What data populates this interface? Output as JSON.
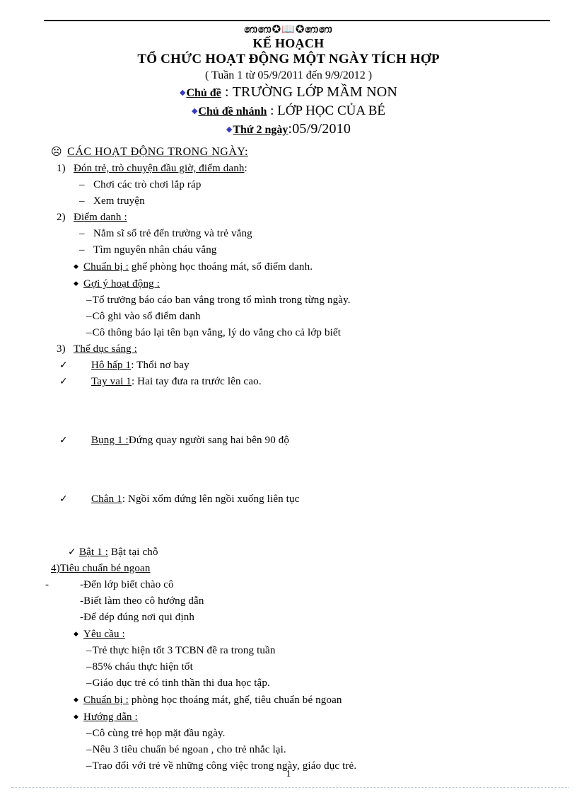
{
  "document": {
    "ornament": "ΨΨ⊛📖⊛ΨΨ",
    "ornament_glyphs": "෩෩✪📖✪෩෩",
    "title_line1": "KẾ HOẠCH",
    "title_line2": "TỔ CHỨC HOẠT ĐỘNG MỘT NGÀY TÍCH HỢP",
    "subtitle": "(  Tuần 1 từ 05/9/2011  đến 9/9/2012  )",
    "page_number": "1"
  },
  "meta": {
    "theme_label": "Chủ đề",
    "theme_value": "TRƯỜNG  LỚP MẦM  NON",
    "subtheme_label": "Chủ đề nhánh",
    "subtheme_value": "LỚP HỌC CỦA BÉ",
    "day_label": "Thứ 2 ngày",
    "day_value": "05/9/2010",
    "bullet_icon": "diamond-icon",
    "colon": ":"
  },
  "section": {
    "icon": "frowning-face-icon",
    "icon_glyph": "☹",
    "heading": "CÁC HOẠT ĐỘNG TRONG NGÀY:"
  },
  "items": [
    {
      "number": "1)",
      "title": "Đón trẻ, trò chuyện đầu giờ, điểm danh",
      "title_suffix": ":",
      "dashes": [
        "Chơi  các trò chơi lắp ráp",
        "Xem truyện"
      ]
    },
    {
      "number": "2)",
      "title": "Điểm danh :",
      "title_suffix": "",
      "dashes": [
        "Nắm sĩ số trẻ đến trường và  trẻ vắng",
        "Tìm nguyên nhân cháu vắng"
      ],
      "bullets": [
        {
          "label": "Chuẩn  bị :",
          "text": " ghế phòng  học thoáng  mát,  sổ điểm danh.",
          "subs": []
        },
        {
          "label": "Gợi ý hoạt động :",
          "text": "",
          "subs": [
            "Tổ  trưởng báo  cáo ban  vắng  trong tổ mình trong từng ngày.",
            "Cô ghi vào  sổ điểm danh",
            "Cô thông báo  lại tên bạn vắng,   lý do vắng  cho cả lớp biết"
          ]
        }
      ]
    },
    {
      "number": "3)",
      "title": "Thể dục sáng :",
      "title_suffix": "",
      "checks": [
        {
          "label": "Hô hấp  1",
          "text": ": Thổi nơ bay",
          "indent": "wide"
        },
        {
          "label": "Tay  vai   1",
          "text": ": Hai tay đưa ra trước lên cao.",
          "indent": "wide"
        },
        {
          "label": "Bụng 1 :",
          "text": "Đứng  quay  người  sang hai bên 90 độ",
          "indent": "wide"
        },
        {
          "label": "Chân 1",
          "text": ":  Ngồi  xổm đứng lên ngồi  xuống  liên tục",
          "indent": "wide"
        },
        {
          "label": "Bật 1 :",
          "text": " Bật tại chỗ",
          "indent": "narrow"
        }
      ]
    },
    {
      "number": "4)",
      "title": "Tiêu chuẩn bé ngoan",
      "title_suffix": "",
      "lead_dash": "-",
      "plain_lines": [
        "-Đến lớp biết chào cô",
        "-Biết làm theo cô hướng  dẫn",
        "-Để dép đúng nơi qui định"
      ],
      "bullets": [
        {
          "label": "Yêu cầu :",
          "text": "",
          "subs": [
            "Trẻ thực hiện tốt 3 TCBN  đề ra trong tuần",
            "85% cháu thực hiện tốt",
            "Giáo dục trẻ có tinh thần thi đua học tập."
          ]
        },
        {
          "label": "Chuẩn  bị :",
          "text": " phòng học thoáng mát, ghế, tiêu chuẩn bé ngoan",
          "subs": []
        },
        {
          "label": "Hướng  dẫn :",
          "text": "",
          "subs": [
            "Cô cùng trẻ họp mặt đầu ngày.",
            "Nêu 3 tiêu chuẩn bé ngoan , cho trẻ nhắc  lại.",
            "Trao đổi với  trẻ về những  công việc trong ngày,  giáo dục trẻ."
          ]
        }
      ]
    }
  ],
  "colors": {
    "text": "#000000",
    "bullet_accent": "#3b3bbf",
    "rule": "#111111",
    "footer_rule": "#9fb6cc"
  }
}
